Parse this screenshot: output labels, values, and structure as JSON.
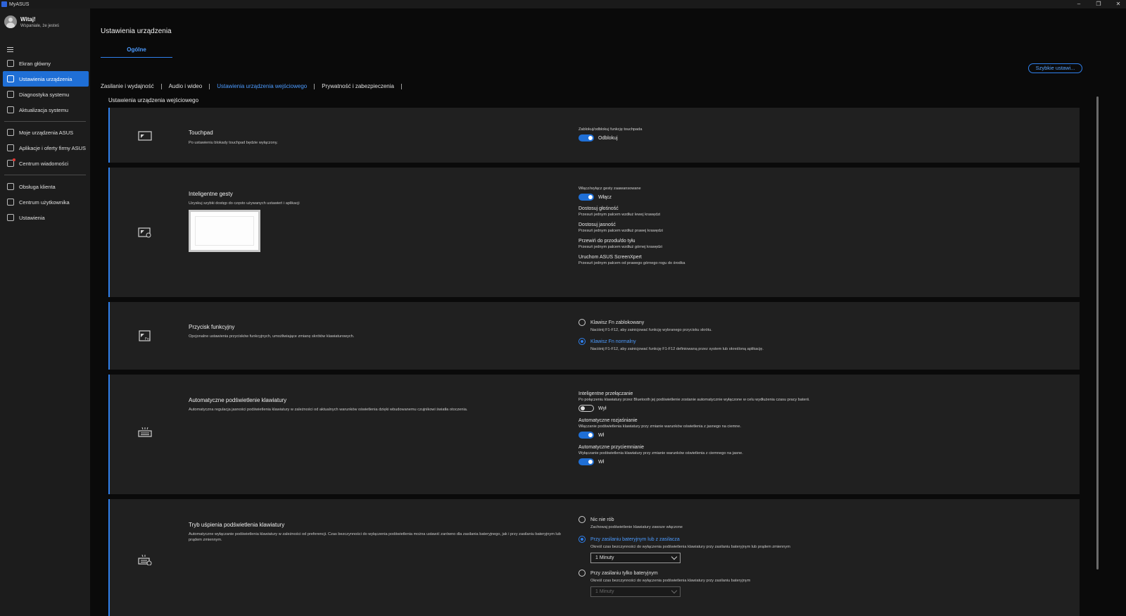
{
  "window": {
    "app_title": "MyASUS",
    "min": "–",
    "max": "❐",
    "close": "✕"
  },
  "user": {
    "greeting": "Witaj!",
    "sub": "Wspaniale, że jesteś"
  },
  "sidebar": {
    "items": [
      {
        "label": "Ekran główny",
        "icon": "home-icon"
      },
      {
        "label": "Ustawienia urządzenia",
        "icon": "sliders-icon"
      },
      {
        "label": "Diagnostyka systemu",
        "icon": "wrench-icon"
      },
      {
        "label": "Aktualizacja systemu",
        "icon": "refresh-icon"
      },
      {
        "label": "Moje urządzenia ASUS",
        "icon": "devices-icon"
      },
      {
        "label": "Aplikacje i oferty firmy ASUS",
        "icon": "apps-grid-icon"
      },
      {
        "label": "Centrum wiadomości",
        "icon": "message-icon"
      },
      {
        "label": "Obsługa klienta",
        "icon": "headset-icon"
      },
      {
        "label": "Centrum użytkownika",
        "icon": "user-icon"
      },
      {
        "label": "Ustawienia",
        "icon": "gear-icon"
      }
    ]
  },
  "main": {
    "page_title": "Ustawienia urządzenia",
    "top_tab": "Ogólne",
    "quick_button": "Szybkie ustawi...",
    "subtabs": [
      "Zasilanie i wydajność",
      "Audio i wideo",
      "Ustawienia urządzenia wejściowego",
      "Prywatność i zabezpieczenia"
    ],
    "section_title": "Ustawienia urządzenia wejściowego"
  },
  "touchpad": {
    "title": "Touchpad",
    "desc": "Po ustawieniu blokady touchpad będzie wyłączony.",
    "control_label": "Zablokuj/odblokuj funkcję touchpada",
    "toggle_label": "Odblokuj"
  },
  "gestures": {
    "title": "Inteligentne gesty",
    "desc": "Uzyskuj szybki dostęp do często używanych ustawień i aplikacji",
    "control_label": "Włącz/wyłącz gesty zaawansowane",
    "toggle_label": "Włącz",
    "items": [
      {
        "title": "Dostosuj głośność",
        "desc": "Przesuń jednym palcem wzdłuż lewej krawędzi"
      },
      {
        "title": "Dostosuj jasność",
        "desc": "Przesuń jednym palcem wzdłuż prawej krawędzi"
      },
      {
        "title": "Przewiń do przodu/do tyłu",
        "desc": "Przesuń jednym palcem wzdłuż górnej krawędzi"
      },
      {
        "title": "Uruchom ASUS ScreenXpert",
        "desc": "Przesuń jednym palcem od prawego górnego rogu do środka"
      }
    ]
  },
  "fnkey": {
    "title": "Przycisk funkcyjny",
    "desc": "Opcjonalne ustawienia przycisków funkcyjnych, umożliwiające zmianę skrótów klawiaturowych.",
    "options": [
      {
        "label": "Klawisz Fn zablokowany",
        "desc": "Naciśnij F1-F12, aby zainicjować funkcję wybranego przycisku skrótu."
      },
      {
        "label": "Klawisz Fn normalny",
        "desc": "Naciśnij F1-F12, aby zainicjować funkcję F1-F12 definiowaną przez system lub określoną aplikację."
      }
    ]
  },
  "backlight": {
    "title": "Automatyczne podświetlenie klawiatury",
    "desc": "Automatyczna regulacja jasności podświetlenia klawiatury w zależności od aktualnych warunków oświetlenia dzięki wbudowanemu czujnikowi światła otoczenia.",
    "smart": {
      "title": "Inteligentne przełączanie",
      "desc": "Po połączeniu klawiatury przez Bluetooth jej podświetlenie zostanie automatycznie wyłączone w celu wydłużenia czasu pracy baterii.",
      "toggle_label": "Wył"
    },
    "brighten": {
      "title": "Automatyczne rozjaśnianie",
      "desc": "Włączanie podświetlenia klawiatury przy zmianie warunków oświetlenia z jasnego na ciemne.",
      "toggle_label": "Wł"
    },
    "dim": {
      "title": "Automatyczne przyciemnianie",
      "desc": "Wyłączanie podświetlenia klawiatury przy zmianie warunków oświetlenia z ciemnego na jasne.",
      "toggle_label": "Wł"
    }
  },
  "sleep": {
    "title": "Tryb uśpienia podświetlenia klawiatury",
    "desc": "Automatyczne wyłączanie podświetlenia klawiatury w zależności od preferencji. Czas bezczynności do wyłączenia podświetlenia można ustawić zarówno dla zasilania bateryjnego, jak i przy zasilaniu bateryjnym lub prądem zmiennym.",
    "options": [
      {
        "label": "Nic nie rób",
        "desc": "Zachowaj podświetlenie klawiatury zawsze włączone"
      },
      {
        "label": "Przy zasilaniu bateryjnym lub z zasilacza",
        "desc": "Określ czas bezczynności do wyłączenia podświetlenia klawiatury przy zasilaniu bateryjnym lub prądem zmiennym",
        "select": "1 Minuty"
      },
      {
        "label": "Przy zasilaniu tylko bateryjnym",
        "desc": "Określ czas bezczynności do wyłączenia podświetlenia klawiatury przy zasilaniu bateryjnym",
        "select": "1 Minuty"
      }
    ]
  }
}
